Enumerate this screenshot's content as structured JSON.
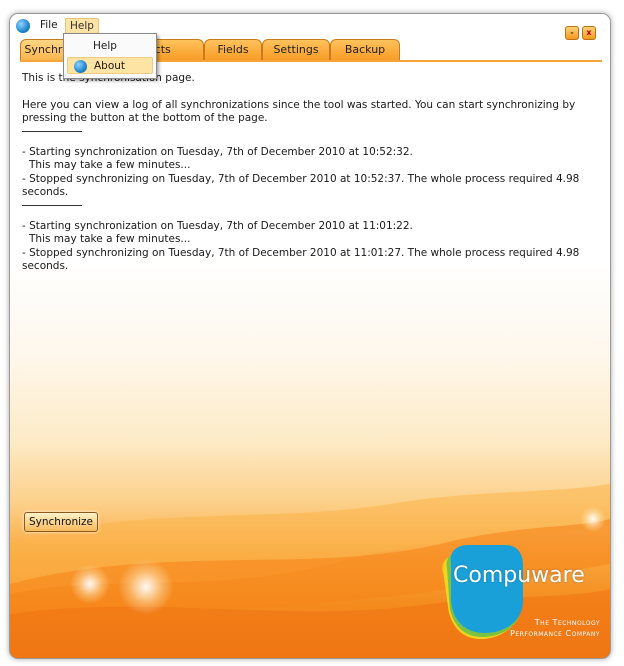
{
  "menu": {
    "file": "File",
    "help": "Help",
    "help_items": [
      "Help",
      "About"
    ]
  },
  "window_buttons": {
    "minimize": "-",
    "close": "x"
  },
  "tabs": [
    "Synchronize",
    "Objects",
    "Fields",
    "Settings",
    "Backup"
  ],
  "content": {
    "intro": "This is the synchronisation page.",
    "description": "Here you can view a log of all synchronizations since the tool was started. You can start synchronizing by pressing the button at the bottom of the page.",
    "log": [
      {
        "start": "- Starting synchronization on Tuesday, 7th of December 2010 at 10:52:32.",
        "wait": "This may take a few minutes...",
        "stop": "- Stopped synchronizing on Tuesday, 7th of December 2010 at 10:52:37. The whole process required 4.98 seconds."
      },
      {
        "start": "- Starting synchronization on Tuesday, 7th of December 2010 at 11:01:22.",
        "wait": "This may take a few minutes...",
        "stop": "- Stopped synchronizing on Tuesday, 7th of December 2010 at 11:01:27. The whole process required 4.98 seconds."
      }
    ]
  },
  "sync_button": "Synchronize",
  "brand": {
    "name": "Compuware",
    "tagline_1": "The Technology",
    "tagline_2": "Performance Company"
  },
  "colors": {
    "accent": "#f89c26",
    "highlight": "#fde3a4"
  }
}
